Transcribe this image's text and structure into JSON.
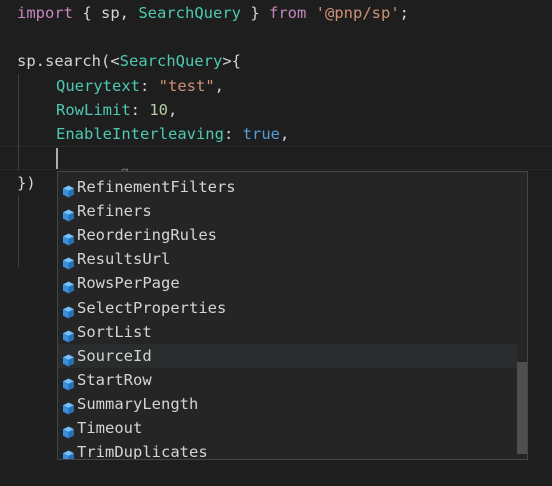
{
  "code": {
    "line1": {
      "import": "import",
      "open": " { ",
      "sp": "sp",
      "comma": ", ",
      "type": "SearchQuery",
      "close": " } ",
      "from": "from",
      "space": " ",
      "module": "'@pnp/sp'",
      "semi": ";"
    },
    "line3": {
      "obj": "sp.search(<",
      "type": "SearchQuery",
      "rest": ">{"
    },
    "line4": {
      "key": "Querytext",
      "colon": ": ",
      "value": "\"test\"",
      "comma": ","
    },
    "line5": {
      "key": "RowLimit",
      "colon": ": ",
      "value": "10",
      "comma": ","
    },
    "line6": {
      "key": "EnableInterleaving",
      "colon": ": ",
      "value": "true",
      "comma": ","
    },
    "line8": "})",
    "ghost": "g"
  },
  "suggestions": {
    "icon": "property-cube-icon",
    "items": [
      "RefinementFilters",
      "Refiners",
      "ReorderingRules",
      "ResultsUrl",
      "RowsPerPage",
      "SelectProperties",
      "SortList",
      "SourceId",
      "StartRow",
      "SummaryLength",
      "Timeout",
      "TrimDuplicates"
    ],
    "selected_index": 7
  },
  "colors": {
    "background": "#1e1e1e",
    "keyword": "#c586c0",
    "type": "#4ec9b0",
    "string": "#ce9178",
    "number": "#b5cea8",
    "boolean": "#569cd6",
    "icon": "#75beff"
  }
}
